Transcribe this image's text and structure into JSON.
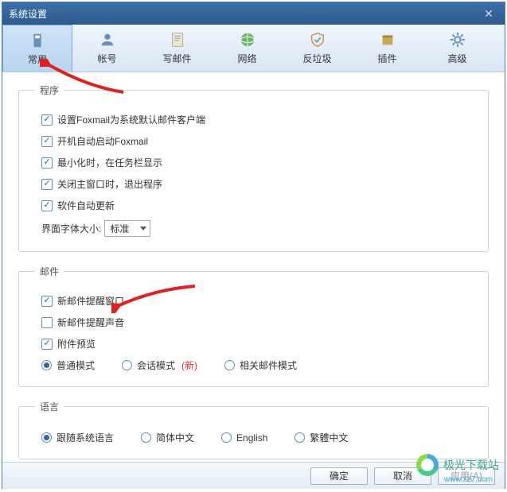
{
  "window": {
    "title": "系统设置"
  },
  "tabs": {
    "general": "常用",
    "account": "帐号",
    "compose": "写邮件",
    "network": "网络",
    "antispam": "反垃圾",
    "plugin": "插件",
    "advanced": "高级"
  },
  "program": {
    "legend": "程序",
    "set_default": "设置Foxmail为系统默认邮件客户端",
    "autostart": "开机自动启动Foxmail",
    "minimize_tray": "最小化时，在任务栏显示",
    "close_exit": "关闭主窗口时，退出程序",
    "auto_update": "软件自动更新",
    "font_label": "界面字体大小:",
    "font_value": "标准"
  },
  "mail": {
    "legend": "邮件",
    "popup": "新邮件提醒窗口",
    "sound": "新邮件提醒声音",
    "preview": "附件预览",
    "mode_normal": "普通模式",
    "mode_thread": "会话模式",
    "mode_new": "(新)",
    "mode_related": "相关邮件模式"
  },
  "language": {
    "legend": "语言",
    "follow": "跟随系统语言",
    "simp": "简体中文",
    "en": "English",
    "trad": "繁體中文"
  },
  "buttons": {
    "ok": "确定",
    "cancel": "取消",
    "apply": "应用(A)"
  },
  "watermark": {
    "text": "极光下载站",
    "url": "www.xz7.com"
  }
}
